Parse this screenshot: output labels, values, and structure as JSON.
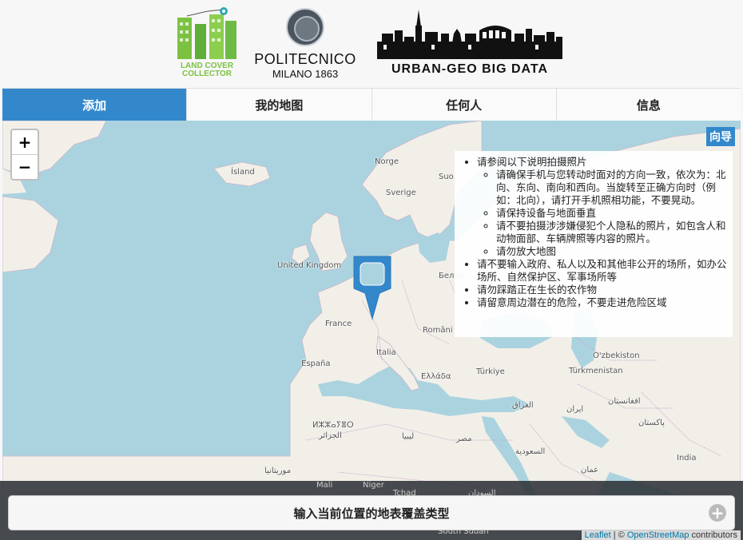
{
  "header": {
    "logos": [
      {
        "name": "land-cover-collector",
        "text": "LAND COVER\nCOLLECTOR"
      },
      {
        "name": "politecnico-milano",
        "line1": "POLITECNICO",
        "line2": "MILANO 1863"
      },
      {
        "name": "urban-geo-big-data",
        "text": "URBAN-GEO BIG DATA"
      }
    ]
  },
  "tabs": [
    {
      "label": "添加",
      "active": true
    },
    {
      "label": "我的地图",
      "active": false
    },
    {
      "label": "任何人",
      "active": false
    },
    {
      "label": "信息",
      "active": false
    }
  ],
  "map": {
    "zoom_in": "+",
    "zoom_out": "−",
    "guide_button": "向导",
    "labels": {
      "island": "Ísland",
      "norge": "Norge",
      "sverige": "Sverige",
      "suomi": "Suo",
      "uk": "United Kingdom",
      "belarus": "Белар",
      "france": "France",
      "romania": "Români",
      "italia": "Italia",
      "espana": "España",
      "ellada": "Ελλάδα",
      "turkiye": "Türkiye",
      "uzbekiston": "O'zbekiston",
      "turkmenistan": "Türkmenistan",
      "afghanistan": "افغانستان",
      "iran": "ایران",
      "iraq": "العراق",
      "pakistan": "پاکستان",
      "algeria1": "ⵍⵣⵣⴰⵢⴻⵔ",
      "algeria2": "الجزائر",
      "libya": "ليبيا",
      "egypt": "مصر",
      "saudi": "السعودية",
      "oman": "عمان",
      "india": "India",
      "mauritania": "موريتانيا",
      "mali": "Mali",
      "niger": "Niger",
      "chad": "Tchad",
      "sudan": "السودان",
      "south_sudan": "South Sudan"
    },
    "attribution": {
      "leaflet": "Leaflet",
      "sep": " | © ",
      "osm": "OpenStreetMap",
      "contributors": " contributors"
    }
  },
  "instructions": {
    "items": [
      {
        "text": "请参阅以下说明拍摄照片",
        "sub": [
          "请确保手机与您转动时面对的方向一致，依次为：北向、东向、南向和西向。当旋转至正确方向时（例如：北向），请打开手机照相功能，不要晃动。",
          "请保持设备与地面垂直",
          "请不要拍摄涉涉嫌侵犯个人隐私的照片，如包含人和动物面部、车辆牌照等内容的照片。",
          "请勿放大地图"
        ]
      },
      {
        "text": "请不要输入政府、私人以及和其他非公开的场所，如办公场所、自然保护区、军事场所等"
      },
      {
        "text": "请勿踩踏正在生长的农作物"
      },
      {
        "text": "请留意周边潜在的危险，不要走进危险区域"
      }
    ]
  },
  "bottom": {
    "enter_label": "输入当前位置的地表覆盖类型",
    "plus_icon": "plus-circle-icon"
  },
  "colors": {
    "accent": "#3388cc",
    "water": "#aad3df",
    "land": "#f2efe9",
    "lcc_green": "#7cc242"
  }
}
